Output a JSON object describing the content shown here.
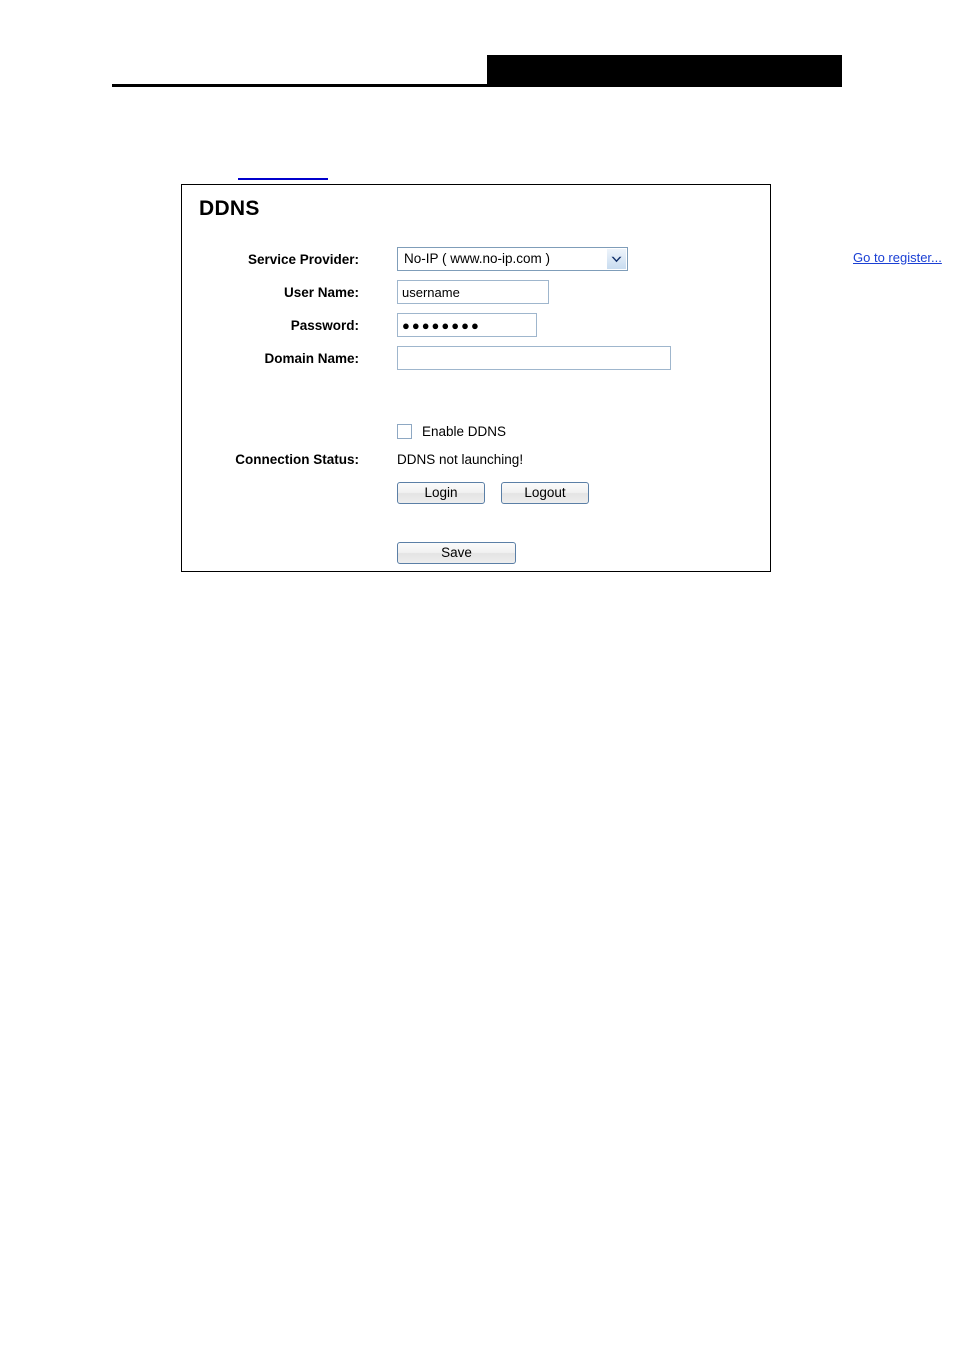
{
  "page": {
    "background_color": "#ffffff"
  },
  "header": {
    "black_bar_label": "",
    "rule_color": "#000000",
    "black_bar_color": "#000000"
  },
  "anchor": {
    "link_text": "",
    "link_color": "#0000cc"
  },
  "panel": {
    "title": "DDNS",
    "border_color": "#000000"
  },
  "form": {
    "service_provider": {
      "label": "Service Provider:",
      "value": "No-IP ( www.no-ip.com )",
      "options": [
        "No-IP ( www.no-ip.com )"
      ],
      "register_link": "Go to register...",
      "register_link_color": "#1a3fd4",
      "dropdown_icon": "chevron-down-icon"
    },
    "user_name": {
      "label": "User Name:",
      "value": "username",
      "placeholder": ""
    },
    "password": {
      "label": "Password:",
      "value": "●●●●●●●●",
      "placeholder": "",
      "masked_char_count": 8
    },
    "domain_name": {
      "label": "Domain Name:",
      "value": "",
      "placeholder": ""
    },
    "enable_ddns": {
      "label": "Enable DDNS",
      "checked": false
    },
    "connection_status": {
      "label": "Connection Status:",
      "value": "DDNS not launching!"
    }
  },
  "buttons": {
    "login": "Login",
    "logout": "Logout",
    "save": "Save"
  }
}
